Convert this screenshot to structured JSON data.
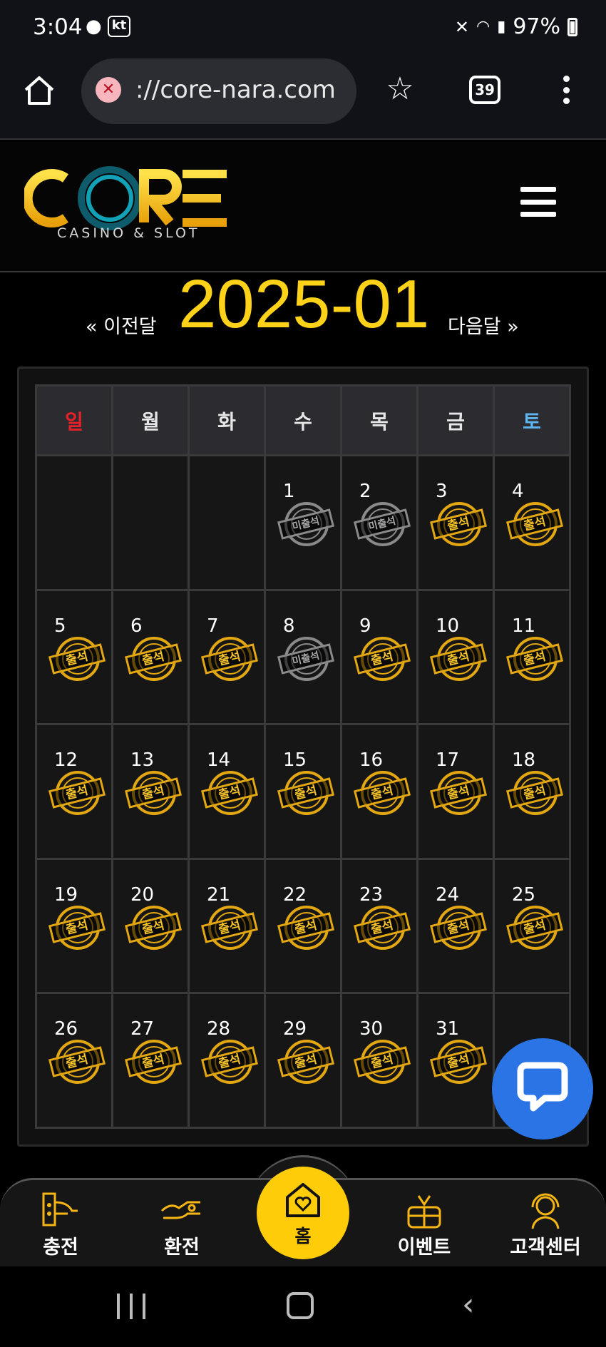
{
  "status_bar": {
    "time": "3:04",
    "carrier": "kt",
    "battery": "97%"
  },
  "browser": {
    "url": "://core-nara.com",
    "tab_count": "39"
  },
  "site": {
    "logo_text": "CORE",
    "logo_subtitle": "CASINO & SLOT"
  },
  "calendar": {
    "prev_label": "« 이전달",
    "month": "2025-01",
    "next_label": "다음달 »",
    "weekdays": [
      "일",
      "월",
      "화",
      "수",
      "목",
      "금",
      "토"
    ],
    "weekday_colors": [
      "#e8202a",
      "#e6e6e6",
      "#e6e6e6",
      "#e6e6e6",
      "#e6e6e6",
      "#e6e6e6",
      "#5db4ee"
    ],
    "stamp_attended": "출석",
    "stamp_absent": "미출석",
    "weeks": [
      [
        null,
        null,
        null,
        {
          "day": "1",
          "status": "absent"
        },
        {
          "day": "2",
          "status": "absent"
        },
        {
          "day": "3",
          "status": "attended"
        },
        {
          "day": "4",
          "status": "attended"
        }
      ],
      [
        {
          "day": "5",
          "status": "attended"
        },
        {
          "day": "6",
          "status": "attended"
        },
        {
          "day": "7",
          "status": "attended"
        },
        {
          "day": "8",
          "status": "absent"
        },
        {
          "day": "9",
          "status": "attended"
        },
        {
          "day": "10",
          "status": "attended"
        },
        {
          "day": "11",
          "status": "attended"
        }
      ],
      [
        {
          "day": "12",
          "status": "attended"
        },
        {
          "day": "13",
          "status": "attended"
        },
        {
          "day": "14",
          "status": "attended"
        },
        {
          "day": "15",
          "status": "attended"
        },
        {
          "day": "16",
          "status": "attended"
        },
        {
          "day": "17",
          "status": "attended"
        },
        {
          "day": "18",
          "status": "attended"
        }
      ],
      [
        {
          "day": "19",
          "status": "attended"
        },
        {
          "day": "20",
          "status": "attended"
        },
        {
          "day": "21",
          "status": "attended"
        },
        {
          "day": "22",
          "status": "attended"
        },
        {
          "day": "23",
          "status": "attended"
        },
        {
          "day": "24",
          "status": "attended"
        },
        {
          "day": "25",
          "status": "attended"
        }
      ],
      [
        {
          "day": "26",
          "status": "attended"
        },
        {
          "day": "27",
          "status": "attended"
        },
        {
          "day": "28",
          "status": "attended"
        },
        {
          "day": "29",
          "status": "attended"
        },
        {
          "day": "30",
          "status": "attended"
        },
        {
          "day": "31",
          "status": "attended"
        },
        null
      ]
    ]
  },
  "bottom_nav": {
    "charge": "충전",
    "exchange": "환전",
    "home": "홈",
    "event": "이벤트",
    "support": "고객센터"
  },
  "colors": {
    "accent": "#ffcc0a",
    "chat": "#2a74e6",
    "stamp_gold": "#e3a712",
    "stamp_grey": "#8a8a8a"
  }
}
